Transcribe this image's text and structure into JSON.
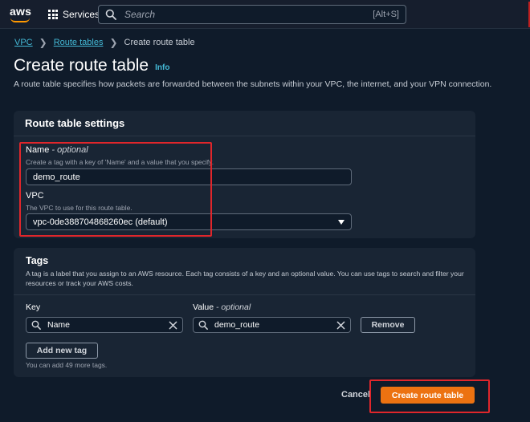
{
  "nav": {
    "logo_text": "aws",
    "services_label": "Services",
    "search_placeholder": "Search",
    "search_shortcut": "[Alt+S]"
  },
  "breadcrumb": {
    "items": [
      "VPC",
      "Route tables"
    ],
    "current": "Create route table"
  },
  "page": {
    "title": "Create route table",
    "info_label": "Info",
    "description": "A route table specifies how packets are forwarded between the subnets within your VPC, the internet, and your VPN connection."
  },
  "settings": {
    "header": "Route table settings",
    "name_label": "Name",
    "name_optional": "- optional",
    "name_hint": "Create a tag with a key of 'Name' and a value that you specify.",
    "name_value": "demo_route",
    "vpc_label": "VPC",
    "vpc_hint": "The VPC to use for this route table.",
    "vpc_value": "vpc-0de388704868260ec (default)"
  },
  "tags": {
    "title": "Tags",
    "description": "A tag is a label that you assign to an AWS resource. Each tag consists of a key and an optional value. You can use tags to search and filter your resources or track your AWS costs.",
    "key_label": "Key",
    "value_label": "Value",
    "value_optional": "- optional",
    "key_value": "Name",
    "value_value": "demo_route",
    "remove_label": "Remove",
    "add_label": "Add new tag",
    "remaining": "You can add 49 more tags."
  },
  "footer": {
    "cancel_label": "Cancel",
    "submit_label": "Create route table"
  },
  "colors": {
    "accent": "#ec7211",
    "link": "#44b9d6",
    "highlight": "#e0262b",
    "background": "#0f1b2a",
    "panel": "#192534"
  }
}
